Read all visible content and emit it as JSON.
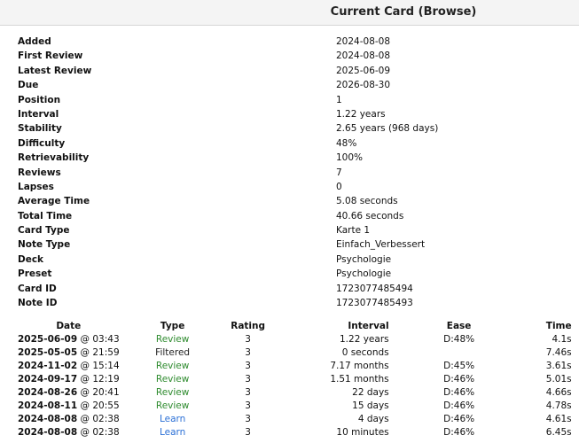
{
  "header": {
    "title": "Current Card (Browse)"
  },
  "card_info": [
    {
      "label": "Added",
      "value": "2024-08-08"
    },
    {
      "label": "First Review",
      "value": "2024-08-08"
    },
    {
      "label": "Latest Review",
      "value": "2025-06-09"
    },
    {
      "label": "Due",
      "value": "2026-08-30"
    },
    {
      "label": "Position",
      "value": "1"
    },
    {
      "label": "Interval",
      "value": "1.22 years"
    },
    {
      "label": "Stability",
      "value": "2.65 years (968 days)"
    },
    {
      "label": "Difficulty",
      "value": "48%"
    },
    {
      "label": "Retrievability",
      "value": "100%"
    },
    {
      "label": "Reviews",
      "value": "7"
    },
    {
      "label": "Lapses",
      "value": "0"
    },
    {
      "label": "Average Time",
      "value": "5.08 seconds"
    },
    {
      "label": "Total Time",
      "value": "40.66 seconds"
    },
    {
      "label": "Card Type",
      "value": "Karte 1"
    },
    {
      "label": "Note Type",
      "value": "Einfach_Verbessert"
    },
    {
      "label": "Deck",
      "value": "Psychologie"
    },
    {
      "label": "Preset",
      "value": "Psychologie"
    },
    {
      "label": "Card ID",
      "value": "1723077485494"
    },
    {
      "label": "Note ID",
      "value": "1723077485493"
    }
  ],
  "revlog": {
    "headers": {
      "date": "Date",
      "type": "Type",
      "rating": "Rating",
      "interval": "Interval",
      "ease": "Ease",
      "time": "Time"
    },
    "rows": [
      {
        "date": "2025-06-09",
        "sep": " @ ",
        "clock": "03:43",
        "type": "Review",
        "type_class": "review",
        "rating": "3",
        "interval": "1.22 years",
        "ease": "D:48%",
        "time": "4.1s"
      },
      {
        "date": "2025-05-05",
        "sep": " @ ",
        "clock": "21:59",
        "type": "Filtered",
        "type_class": "filtered",
        "rating": "3",
        "interval": "0 seconds",
        "ease": "",
        "time": "7.46s"
      },
      {
        "date": "2024-11-02",
        "sep": " @ ",
        "clock": "15:14",
        "type": "Review",
        "type_class": "review",
        "rating": "3",
        "interval": "7.17 months",
        "ease": "D:45%",
        "time": "3.61s"
      },
      {
        "date": "2024-09-17",
        "sep": " @ ",
        "clock": "12:19",
        "type": "Review",
        "type_class": "review",
        "rating": "3",
        "interval": "1.51 months",
        "ease": "D:46%",
        "time": "5.01s"
      },
      {
        "date": "2024-08-26",
        "sep": " @ ",
        "clock": "20:41",
        "type": "Review",
        "type_class": "review",
        "rating": "3",
        "interval": "22 days",
        "ease": "D:46%",
        "time": "4.66s"
      },
      {
        "date": "2024-08-11",
        "sep": " @ ",
        "clock": "20:55",
        "type": "Review",
        "type_class": "review",
        "rating": "3",
        "interval": "15 days",
        "ease": "D:46%",
        "time": "4.78s"
      },
      {
        "date": "2024-08-08",
        "sep": " @ ",
        "clock": "02:38",
        "type": "Learn",
        "type_class": "learn",
        "rating": "3",
        "interval": "4 days",
        "ease": "D:46%",
        "time": "4.61s"
      },
      {
        "date": "2024-08-08",
        "sep": " @ ",
        "clock": "02:38",
        "type": "Learn",
        "type_class": "learn",
        "rating": "3",
        "interval": "10 minutes",
        "ease": "D:46%",
        "time": "6.45s"
      }
    ]
  },
  "colors": {
    "review": "#2e8b2e",
    "learn": "#2a6fd6",
    "filtered": "#222222",
    "header_bg": "#f4f4f4"
  }
}
